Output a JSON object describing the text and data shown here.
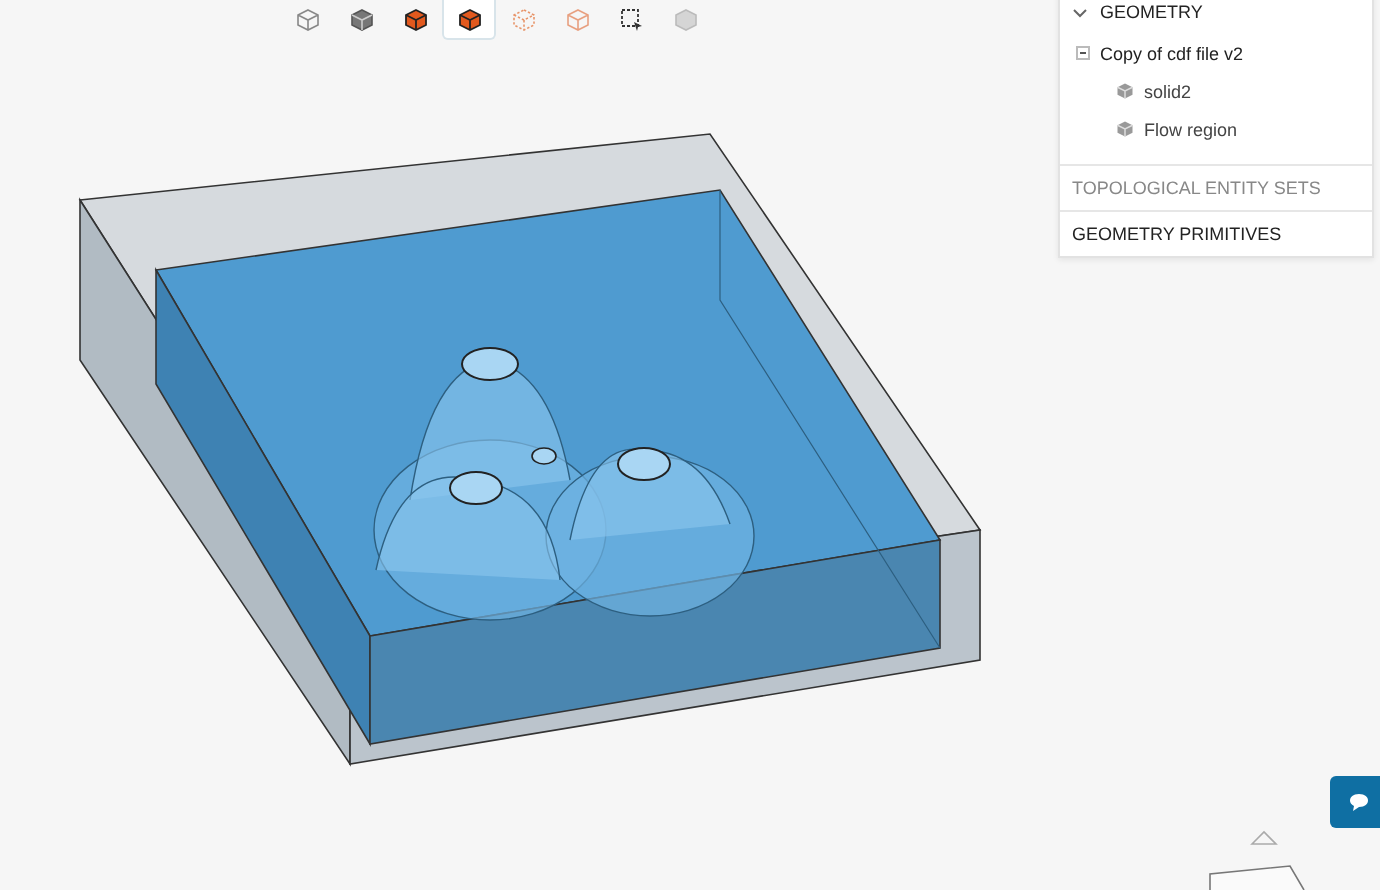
{
  "toolbar": [
    {
      "kind": "outline",
      "selected": false
    },
    {
      "kind": "solid",
      "selected": false
    },
    {
      "kind": "orange-solid",
      "selected": false
    },
    {
      "kind": "orange-solid",
      "selected": true
    },
    {
      "kind": "orange-dashed",
      "selected": false
    },
    {
      "kind": "orange-outline",
      "selected": false
    },
    {
      "kind": "box-select",
      "selected": false
    },
    {
      "kind": "faded",
      "selected": false
    }
  ],
  "panel": {
    "sections": [
      {
        "title": "GEOMETRY",
        "expanded": true,
        "disabled": false,
        "tree": [
          {
            "label": "Copy of cdf file v2",
            "expanded": true,
            "children": [
              {
                "label": "solid2"
              },
              {
                "label": "Flow region"
              }
            ]
          }
        ]
      },
      {
        "title": "TOPOLOGICAL ENTITY SETS",
        "expanded": false,
        "disabled": true
      },
      {
        "title": "GEOMETRY PRIMITIVES",
        "expanded": false,
        "disabled": false
      }
    ]
  }
}
